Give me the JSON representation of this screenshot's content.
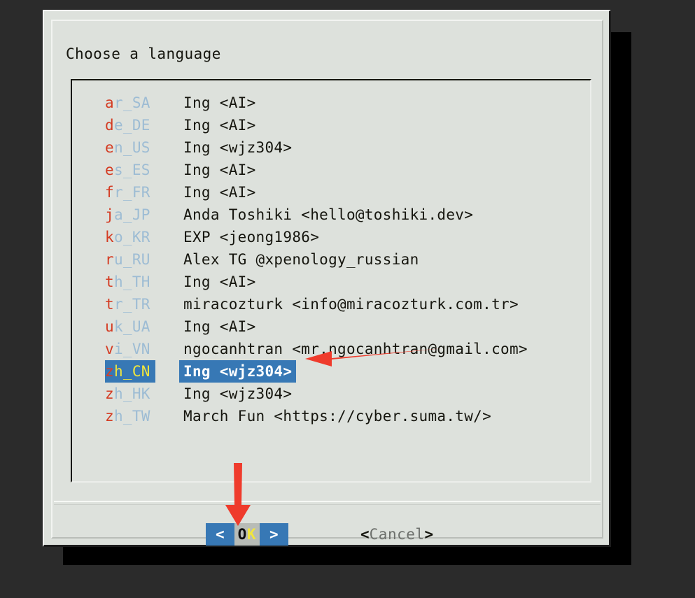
{
  "window": {
    "title": "Choose a language",
    "background_color": "#2b2b2b",
    "dialog_color": "#dde1dc"
  },
  "list": {
    "rows": [
      {
        "code_hot": "a",
        "code_rest": "r_SA",
        "code": "ar_SA",
        "desc": "Ing <AI>",
        "selected": false
      },
      {
        "code_hot": "d",
        "code_rest": "e_DE",
        "code": "de_DE",
        "desc": "Ing <AI>",
        "selected": false
      },
      {
        "code_hot": "e",
        "code_rest": "n_US",
        "code": "en_US",
        "desc": "Ing <wjz304>",
        "selected": false
      },
      {
        "code_hot": "e",
        "code_rest": "s_ES",
        "code": "es_ES",
        "desc": "Ing <AI>",
        "selected": false
      },
      {
        "code_hot": "f",
        "code_rest": "r_FR",
        "code": "fr_FR",
        "desc": "Ing <AI>",
        "selected": false
      },
      {
        "code_hot": "j",
        "code_rest": "a_JP",
        "code": "ja_JP",
        "desc": "Anda Toshiki <hello@toshiki.dev>",
        "selected": false
      },
      {
        "code_hot": "k",
        "code_rest": "o_KR",
        "code": "ko_KR",
        "desc": "EXP <jeong1986>",
        "selected": false
      },
      {
        "code_hot": "r",
        "code_rest": "u_RU",
        "code": "ru_RU",
        "desc": "Alex TG @xpenology_russian",
        "selected": false
      },
      {
        "code_hot": "t",
        "code_rest": "h_TH",
        "code": "th_TH",
        "desc": "Ing <AI>",
        "selected": false
      },
      {
        "code_hot": "t",
        "code_rest": "r_TR",
        "code": "tr_TR",
        "desc": "miracozturk <info@miracozturk.com.tr>",
        "selected": false
      },
      {
        "code_hot": "u",
        "code_rest": "k_UA",
        "code": "uk_UA",
        "desc": "Ing <AI>",
        "selected": false
      },
      {
        "code_hot": "v",
        "code_rest": "i_VN",
        "code": "vi_VN",
        "desc": "ngocanhtran <mr.ngocanhtran@gmail.com>",
        "selected": false
      },
      {
        "code_hot": "z",
        "code_rest": "h_CN",
        "code": "zh_CN",
        "desc": "Ing <wjz304>",
        "selected": true
      },
      {
        "code_hot": "z",
        "code_rest": "h_HK",
        "code": "zh_HK",
        "desc": "Ing <wjz304>",
        "selected": false
      },
      {
        "code_hot": "z",
        "code_rest": "h_TW",
        "code": "zh_TW",
        "desc": "March Fun <https://cyber.suma.tw/>",
        "selected": false
      }
    ],
    "selected_code": "zh_CN",
    "selected_color": "#3778b5",
    "hotkey_color": "#d43b22",
    "code_color": "#9dbcd4"
  },
  "buttons": {
    "ok": {
      "arrow_left": "<",
      "label_hot": "O",
      "label_rest": "K",
      "label": "OK",
      "arrow_right": ">",
      "focused": true
    },
    "cancel": {
      "bracket_left": "<",
      "label": "Cancel",
      "bracket_right": ">",
      "focused": false
    }
  },
  "annotations": {
    "arrow_color": "#ef3b2c",
    "arrows": [
      {
        "name": "arrow-to-selected-row",
        "direction": "left",
        "points_at": "zh_CN"
      },
      {
        "name": "arrow-to-ok-button",
        "direction": "down",
        "points_at": "OK"
      }
    ]
  }
}
